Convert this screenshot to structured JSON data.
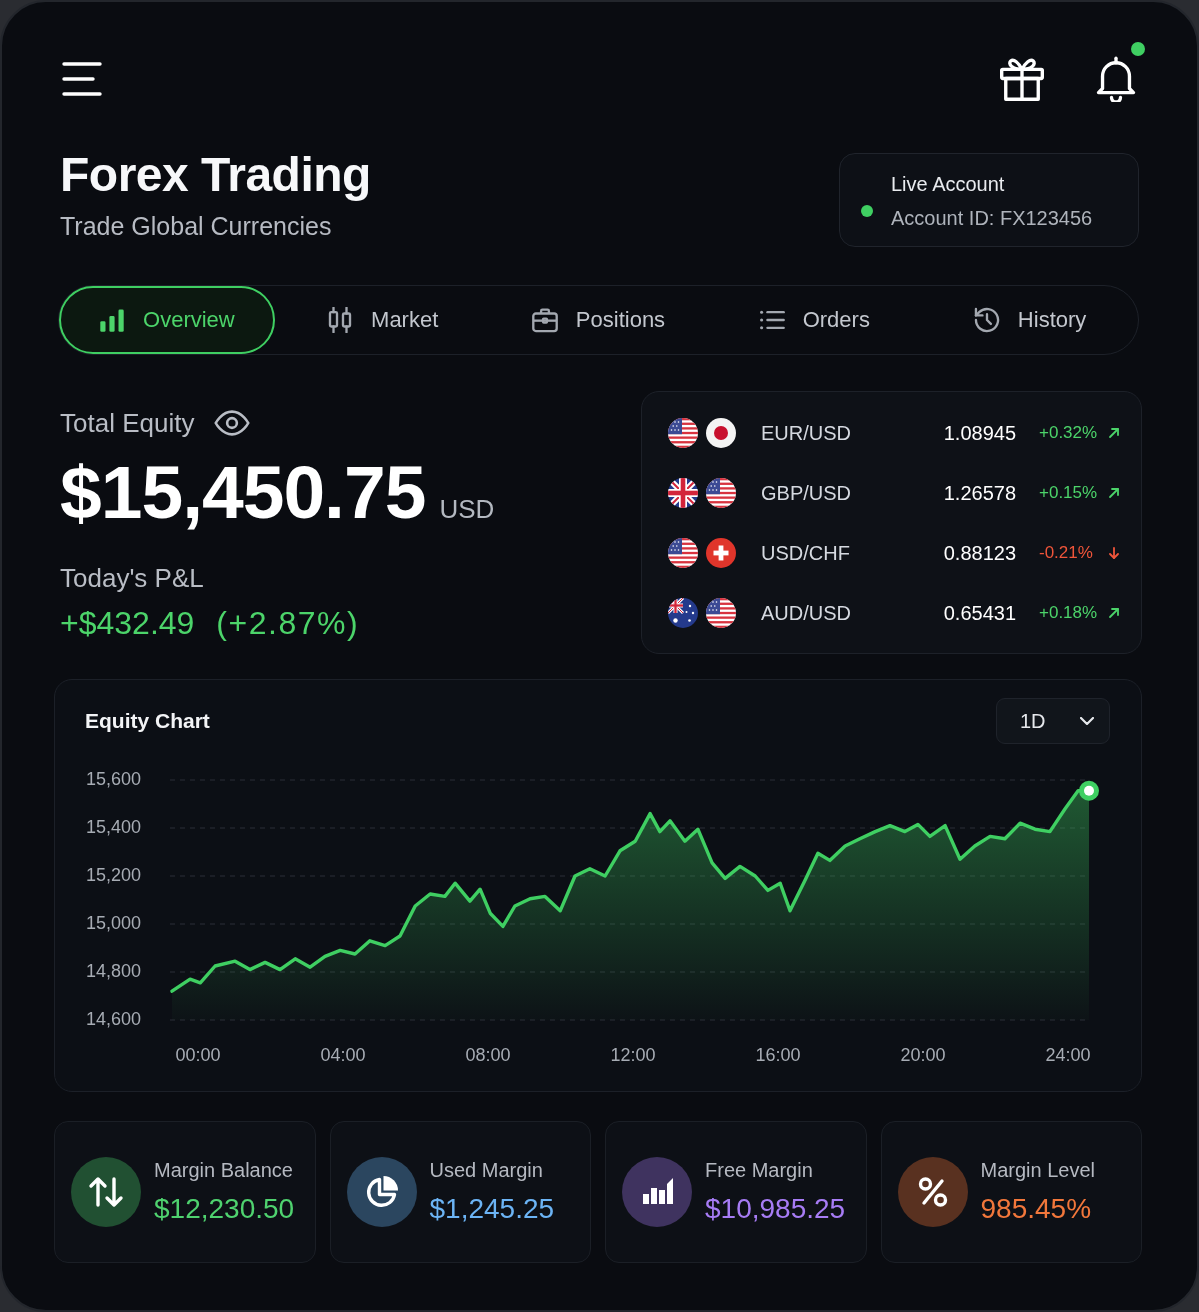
{
  "top_bar": {
    "bell": {
      "unread": true
    }
  },
  "title": "Forex Trading",
  "subtitle": "Trade Global Currencies",
  "account": {
    "label": "Live Account",
    "id": "Account ID: FX123456"
  },
  "tabs": [
    {
      "label": "Overview",
      "kind": "bars",
      "selected": true
    },
    {
      "label": "Market",
      "kind": "candles",
      "selected": false
    },
    {
      "label": "Positions",
      "kind": "briefcase",
      "selected": false
    },
    {
      "label": "Orders",
      "kind": "list",
      "selected": false
    },
    {
      "label": "History",
      "kind": "history",
      "selected": false
    }
  ],
  "equity": {
    "label": "Total Equity",
    "value": "$15,450.75",
    "currency": "USD"
  },
  "pnl": {
    "label": "Today's P&L",
    "value": "+$432.49",
    "percent": "(+2.87%)",
    "rising": true
  },
  "pairs": [
    {
      "flags": [
        {
          "kind": "us"
        },
        {
          "kind": "jp"
        }
      ],
      "pair": "EUR/USD",
      "price": "1.08945",
      "change": "+0.32%",
      "rising": true
    },
    {
      "flags": [
        {
          "kind": "gb"
        },
        {
          "kind": "us"
        }
      ],
      "pair": "GBP/USD",
      "price": "1.26578",
      "change": "+0.15%",
      "rising": true
    },
    {
      "flags": [
        {
          "kind": "us"
        },
        {
          "kind": "ch"
        }
      ],
      "pair": "USD/CHF",
      "price": "0.88123",
      "change": "-0.21%",
      "rising": false
    },
    {
      "flags": [
        {
          "kind": "au"
        },
        {
          "kind": "us"
        }
      ],
      "pair": "AUD/USD",
      "price": "0.65431",
      "change": "+0.18%",
      "rising": true
    }
  ],
  "equity_chart": {
    "range": "1D",
    "chart_data": {
      "type": "area",
      "title": "Equity Chart",
      "grid": true,
      "x": [
        -0.72,
        -0.22,
        0.06,
        0.47,
        1.02,
        1.43,
        1.85,
        2.26,
        2.68,
        3.09,
        3.5,
        3.92,
        4.33,
        4.74,
        5.16,
        5.57,
        5.99,
        6.4,
        6.81,
        7.09,
        7.5,
        7.78,
        8.06,
        8.41,
        8.74,
        9.16,
        9.57,
        9.99,
        10.4,
        10.81,
        11.23,
        11.64,
        12.06,
        12.47,
        12.74,
        13.02,
        13.43,
        13.79,
        14.18,
        14.54,
        14.95,
        15.37,
        15.72,
        16.06,
        16.33,
        16.74,
        17.1,
        17.43,
        17.85,
        18.26,
        18.68,
        19.09,
        19.5,
        19.86,
        20.19,
        20.61,
        21.02,
        21.43,
        21.85,
        22.26,
        22.68,
        23.09,
        23.5,
        23.92,
        24.28,
        24.58
      ],
      "series": [
        {
          "color": "#3fcf62",
          "values": [
            14720,
            14770,
            14755,
            14825,
            14845,
            14810,
            14840,
            14810,
            14855,
            14820,
            14865,
            14890,
            14875,
            14930,
            14910,
            14950,
            15075,
            15125,
            15115,
            15170,
            15095,
            15145,
            15045,
            14990,
            15075,
            15105,
            15115,
            15055,
            15200,
            15230,
            15200,
            15305,
            15345,
            15460,
            15385,
            15430,
            15345,
            15395,
            15255,
            15190,
            15240,
            15200,
            15140,
            15170,
            15055,
            15180,
            15295,
            15265,
            15325,
            15355,
            15385,
            15410,
            15385,
            15415,
            15365,
            15410,
            15270,
            15325,
            15365,
            15355,
            15420,
            15395,
            15385,
            15480,
            15555,
            15555
          ]
        }
      ],
      "xlim": [
        -0.72,
        24.58
      ],
      "ylim": [
        14600,
        15600
      ],
      "xticks": [
        {
          "value": 0,
          "label": "00:00"
        },
        {
          "value": 4,
          "label": "04:00"
        },
        {
          "value": 8,
          "label": "08:00"
        },
        {
          "value": 12,
          "label": "12:00"
        },
        {
          "value": 16,
          "label": "16:00"
        },
        {
          "value": 20,
          "label": "20:00"
        },
        {
          "value": 24,
          "label": "24:00"
        }
      ],
      "yticks": [
        {
          "value": 15600,
          "label": "15,600"
        },
        {
          "value": 15400,
          "label": "15,400"
        },
        {
          "value": 15200,
          "label": "15,200"
        },
        {
          "value": 15000,
          "label": "15,000"
        },
        {
          "value": 14800,
          "label": "14,800"
        },
        {
          "value": 14600,
          "label": "14,600"
        }
      ]
    }
  },
  "stats": [
    {
      "label": "Margin Balance",
      "value": "$12,230.50",
      "kind": "arrows",
      "color": "#4fd26f"
    },
    {
      "label": "Used Margin",
      "value": "$1,245.25",
      "kind": "pie",
      "color": "#6cb4f5"
    },
    {
      "label": "Free Margin",
      "value": "$10,985.25",
      "kind": "bars",
      "color": "#a77cf5"
    },
    {
      "label": "Margin Level",
      "value": "985.45%",
      "kind": "percent",
      "color": "#f2773b"
    }
  ]
}
